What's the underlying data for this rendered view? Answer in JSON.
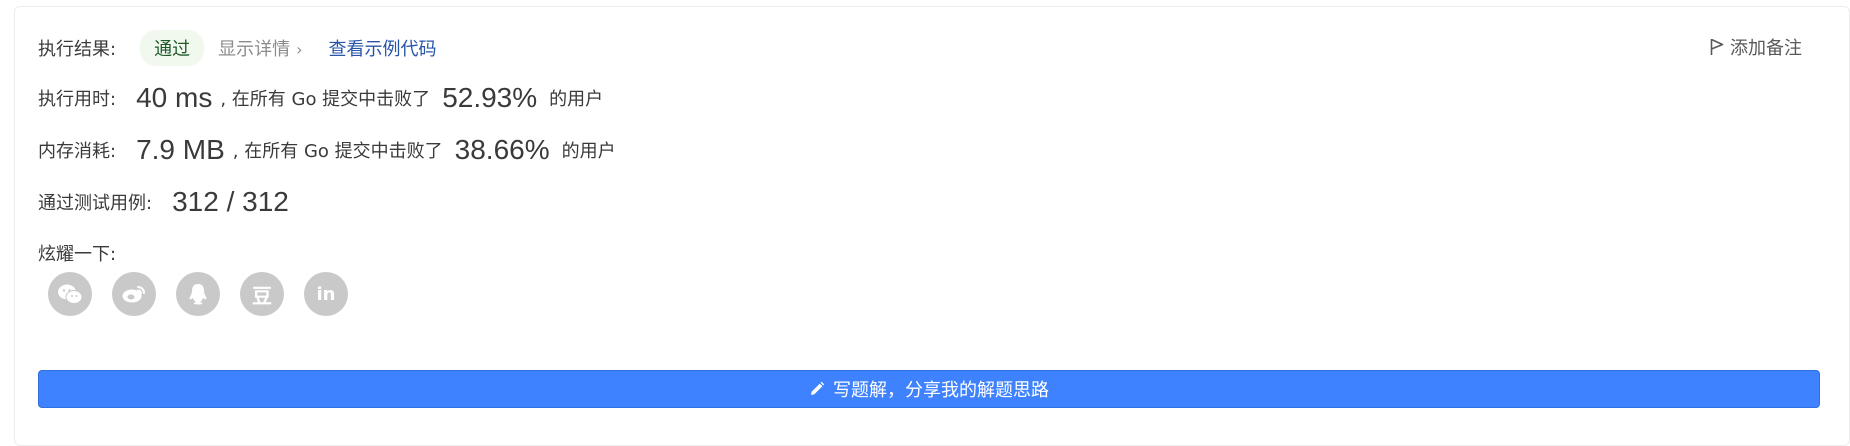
{
  "result": {
    "label": "执行结果:",
    "status": "通过",
    "details_link": "显示详情",
    "details_chevron": "›",
    "sample_code_link": "查看示例代码"
  },
  "add_note_label": "添加备注",
  "runtime": {
    "label": "执行用时:",
    "value": "40 ms",
    "middle_text": ", 在所有 Go 提交中击败了",
    "percent": "52.93%",
    "suffix": "的用户"
  },
  "memory": {
    "label": "内存消耗:",
    "value": "7.9 MB",
    "middle_text": ", 在所有 Go 提交中击败了",
    "percent": "38.66%",
    "suffix": "的用户"
  },
  "testcases": {
    "label": "通过测试用例:",
    "value": "312 / 312"
  },
  "share": {
    "label": "炫耀一下:",
    "icons": [
      "wechat-icon",
      "weibo-icon",
      "qq-icon",
      "douban-icon",
      "linkedin-icon"
    ],
    "douban_glyph": "豆",
    "linkedin_glyph": "in"
  },
  "solution_button_label": "写题解，分享我的解题思路",
  "colors": {
    "primary": "#3f82ff",
    "pass_badge_bg": "#f1f8ee",
    "pass_badge_text": "#1e5a2a",
    "link": "#2855a8",
    "share_icon_bg": "#c9c9c9"
  }
}
